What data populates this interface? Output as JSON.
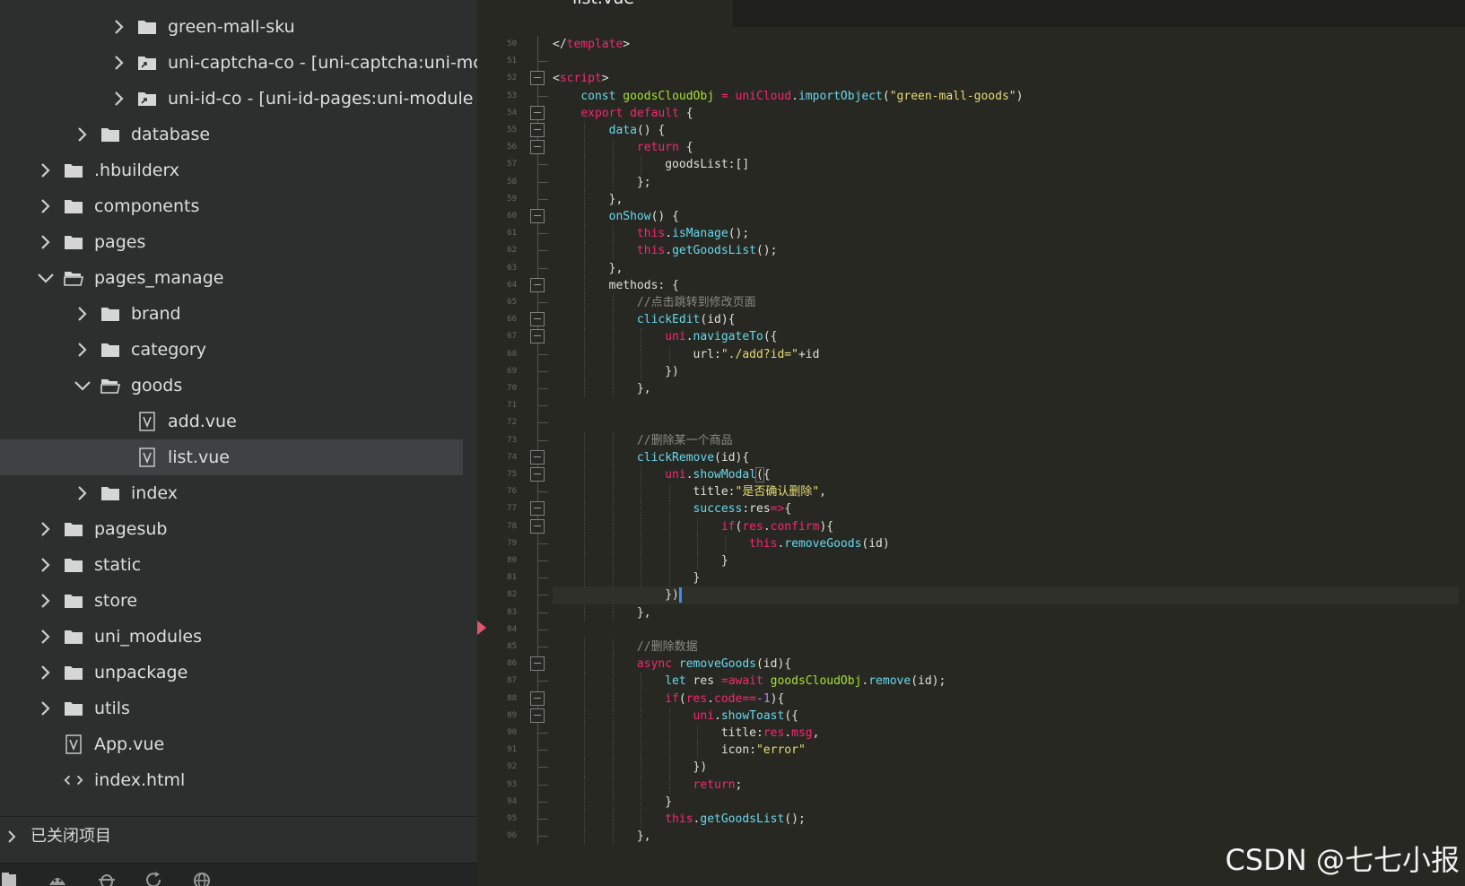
{
  "sidebar": {
    "tree": [
      {
        "label": "green-mall-sku",
        "type": "folder",
        "expanded": false
      },
      {
        "label": "uni-captcha-co - [uni-captcha:uni-mc",
        "type": "linked-folder",
        "expanded": false
      },
      {
        "label": "uni-id-co - [uni-id-pages:uni-module",
        "type": "linked-folder",
        "expanded": false
      },
      {
        "label": "database",
        "type": "folder",
        "expanded": false
      },
      {
        "label": ".hbuilderx",
        "type": "folder",
        "expanded": false
      },
      {
        "label": "components",
        "type": "folder",
        "expanded": false
      },
      {
        "label": "pages",
        "type": "folder",
        "expanded": false
      },
      {
        "label": "pages_manage",
        "type": "folder",
        "expanded": true
      },
      {
        "label": "brand",
        "type": "folder",
        "expanded": false
      },
      {
        "label": "category",
        "type": "folder",
        "expanded": false
      },
      {
        "label": "goods",
        "type": "folder",
        "expanded": true
      },
      {
        "label": "add.vue",
        "type": "vue-file"
      },
      {
        "label": "list.vue",
        "type": "vue-file",
        "selected": true
      },
      {
        "label": "index",
        "type": "folder",
        "expanded": false
      },
      {
        "label": "pagesub",
        "type": "folder",
        "expanded": false
      },
      {
        "label": "static",
        "type": "folder",
        "expanded": false
      },
      {
        "label": "store",
        "type": "folder",
        "expanded": false
      },
      {
        "label": "uni_modules",
        "type": "folder",
        "expanded": false
      },
      {
        "label": "unpackage",
        "type": "folder",
        "expanded": false
      },
      {
        "label": "utils",
        "type": "folder",
        "expanded": false
      },
      {
        "label": "App.vue",
        "type": "vue-file"
      },
      {
        "label": "index.html",
        "type": "html-file"
      }
    ],
    "closed_projects_label": "已关闭项目",
    "bottom_icons": [
      "files-icon",
      "android-icon",
      "debug-bug-icon",
      "refresh-icon",
      "globe-icon"
    ]
  },
  "editor": {
    "active_tab": "list.vue",
    "current_line": 82,
    "line_numbers": [
      "50",
      "51",
      "52",
      "53",
      "54",
      "55",
      "56",
      "57",
      "58",
      "59",
      "60",
      "61",
      "62",
      "63",
      "64",
      "65",
      "66",
      "67",
      "68",
      "69",
      "70",
      "71",
      "72",
      "73",
      "74",
      "75",
      "76",
      "77",
      "78",
      "79",
      "80",
      "81",
      "82",
      "83",
      "84",
      "85",
      "86",
      "87",
      "88",
      "89",
      "90",
      "91",
      "92",
      "93",
      "94",
      "95",
      "96"
    ],
    "lines": [
      [
        [
          "",
          "</"
        ],
        [
          "tg",
          "template"
        ],
        [
          "",
          ">"
        ]
      ],
      [],
      [
        [
          "",
          "<"
        ],
        [
          "tg",
          "script"
        ],
        [
          "",
          ">"
        ]
      ],
      [
        [
          "",
          "    "
        ],
        [
          "kb",
          "const"
        ],
        [
          "",
          " "
        ],
        [
          "sg",
          "goodsCloudObj"
        ],
        [
          "",
          " "
        ],
        [
          "k",
          "="
        ],
        [
          "",
          " "
        ],
        [
          "k",
          "uniCloud"
        ],
        [
          "",
          "."
        ],
        [
          "f",
          "importObject"
        ],
        [
          "",
          "("
        ],
        [
          "s",
          "\"green-mall-goods\""
        ],
        [
          "",
          ")"
        ]
      ],
      [
        [
          "",
          "    "
        ],
        [
          "k",
          "export"
        ],
        [
          "",
          " "
        ],
        [
          "k",
          "default"
        ],
        [
          "",
          " {"
        ]
      ],
      [
        [
          "",
          "        "
        ],
        [
          "f",
          "data"
        ],
        [
          "",
          "() {"
        ]
      ],
      [
        [
          "",
          "            "
        ],
        [
          "k",
          "return"
        ],
        [
          "",
          " {"
        ]
      ],
      [
        [
          "",
          "                goodsList:[]"
        ]
      ],
      [
        [
          "",
          "            };"
        ]
      ],
      [
        [
          "",
          "        },"
        ]
      ],
      [
        [
          "",
          "        "
        ],
        [
          "f",
          "onShow"
        ],
        [
          "",
          "() {"
        ]
      ],
      [
        [
          "",
          "            "
        ],
        [
          "k",
          "this"
        ],
        [
          "",
          "."
        ],
        [
          "f",
          "isManage"
        ],
        [
          "",
          "();"
        ]
      ],
      [
        [
          "",
          "            "
        ],
        [
          "k",
          "this"
        ],
        [
          "",
          "."
        ],
        [
          "f",
          "getGoodsList"
        ],
        [
          "",
          "();"
        ]
      ],
      [
        [
          "",
          "        },"
        ]
      ],
      [
        [
          "",
          "        methods: {"
        ]
      ],
      [
        [
          "",
          "            "
        ],
        [
          "c",
          "//点击跳转到修改页面"
        ]
      ],
      [
        [
          "",
          "            "
        ],
        [
          "f",
          "clickEdit"
        ],
        [
          "",
          "(id){"
        ]
      ],
      [
        [
          "",
          "                "
        ],
        [
          "k",
          "uni"
        ],
        [
          "",
          "."
        ],
        [
          "f",
          "navigateTo"
        ],
        [
          "",
          "({"
        ]
      ],
      [
        [
          "",
          "                    url:"
        ],
        [
          "s",
          "\"./add?id=\""
        ],
        [
          "",
          "+id"
        ]
      ],
      [
        [
          "",
          "                })"
        ]
      ],
      [
        [
          "",
          "            },"
        ]
      ],
      [],
      [],
      [
        [
          "",
          "            "
        ],
        [
          "c",
          "//删除某一个商品"
        ]
      ],
      [
        [
          "",
          "            "
        ],
        [
          "f",
          "clickRemove"
        ],
        [
          "",
          "(id){"
        ]
      ],
      [
        [
          "",
          "                "
        ],
        [
          "k",
          "uni"
        ],
        [
          "",
          "."
        ],
        [
          "f",
          "showModal"
        ],
        [
          "box",
          "("
        ],
        [
          "",
          "{"
        ]
      ],
      [
        [
          "",
          "                    title:"
        ],
        [
          "s",
          "\"是否确认删除\""
        ],
        [
          "",
          ","
        ]
      ],
      [
        [
          "",
          "                    "
        ],
        [
          "f",
          "success"
        ],
        [
          "",
          ":res"
        ],
        [
          "k",
          "=>"
        ],
        [
          "",
          "{"
        ]
      ],
      [
        [
          "",
          "                        "
        ],
        [
          "k",
          "if"
        ],
        [
          "",
          "("
        ],
        [
          "k",
          "res"
        ],
        [
          "",
          "."
        ],
        [
          "k",
          "confirm"
        ],
        [
          "",
          "){"
        ]
      ],
      [
        [
          "",
          "                            "
        ],
        [
          "k",
          "this"
        ],
        [
          "",
          "."
        ],
        [
          "f",
          "removeGoods"
        ],
        [
          "",
          "(id)"
        ]
      ],
      [
        [
          "",
          "                        }"
        ]
      ],
      [
        [
          "",
          "                    }"
        ]
      ],
      [
        [
          "",
          "                })"
        ],
        [
          "caret",
          ""
        ]
      ],
      [
        [
          "",
          "            },"
        ]
      ],
      [],
      [
        [
          "",
          "            "
        ],
        [
          "c",
          "//删除数据"
        ]
      ],
      [
        [
          "",
          "            "
        ],
        [
          "k",
          "async"
        ],
        [
          "",
          " "
        ],
        [
          "f",
          "removeGoods"
        ],
        [
          "",
          "(id){"
        ]
      ],
      [
        [
          "",
          "                "
        ],
        [
          "kb",
          "let"
        ],
        [
          "",
          " res "
        ],
        [
          "k",
          "="
        ],
        [
          "k",
          "await"
        ],
        [
          "",
          " "
        ],
        [
          "sg",
          "goodsCloudObj"
        ],
        [
          "",
          "."
        ],
        [
          "f",
          "remove"
        ],
        [
          "",
          "(id);"
        ]
      ],
      [
        [
          "",
          "                "
        ],
        [
          "k",
          "if"
        ],
        [
          "",
          "("
        ],
        [
          "k",
          "res"
        ],
        [
          "",
          "."
        ],
        [
          "k",
          "code"
        ],
        [
          "k",
          "=="
        ],
        [
          "n",
          "-1"
        ],
        [
          "",
          "){"
        ]
      ],
      [
        [
          "",
          "                    "
        ],
        [
          "k",
          "uni"
        ],
        [
          "",
          "."
        ],
        [
          "f",
          "showToast"
        ],
        [
          "",
          "({"
        ]
      ],
      [
        [
          "",
          "                        title:"
        ],
        [
          "k",
          "res"
        ],
        [
          "",
          "."
        ],
        [
          "k",
          "msg"
        ],
        [
          "",
          ","
        ]
      ],
      [
        [
          "",
          "                        icon:"
        ],
        [
          "s",
          "\"error\""
        ]
      ],
      [
        [
          "",
          "                    })"
        ]
      ],
      [
        [
          "",
          "                    "
        ],
        [
          "k",
          "return"
        ],
        [
          "",
          ";"
        ]
      ],
      [
        [
          "",
          "                }"
        ]
      ],
      [
        [
          "",
          "                "
        ],
        [
          "k",
          "this"
        ],
        [
          "",
          "."
        ],
        [
          "f",
          "getGoodsList"
        ],
        [
          "",
          "();"
        ]
      ],
      [
        [
          "",
          "            },"
        ]
      ]
    ],
    "fold_markers": [
      52,
      54,
      55,
      56,
      60,
      64,
      66,
      67,
      74,
      75,
      77,
      78,
      86,
      88,
      89
    ]
  },
  "watermark": "CSDN @七七小报",
  "colors": {
    "sidebar_bg": "#2d2e2e",
    "selection_bg": "#3f4142",
    "editor_bg": "#272822",
    "keyword": "#f92672",
    "function": "#66d9ef",
    "string": "#e6db74",
    "comment": "#8a8b85",
    "caret": "#3c8dfa"
  }
}
